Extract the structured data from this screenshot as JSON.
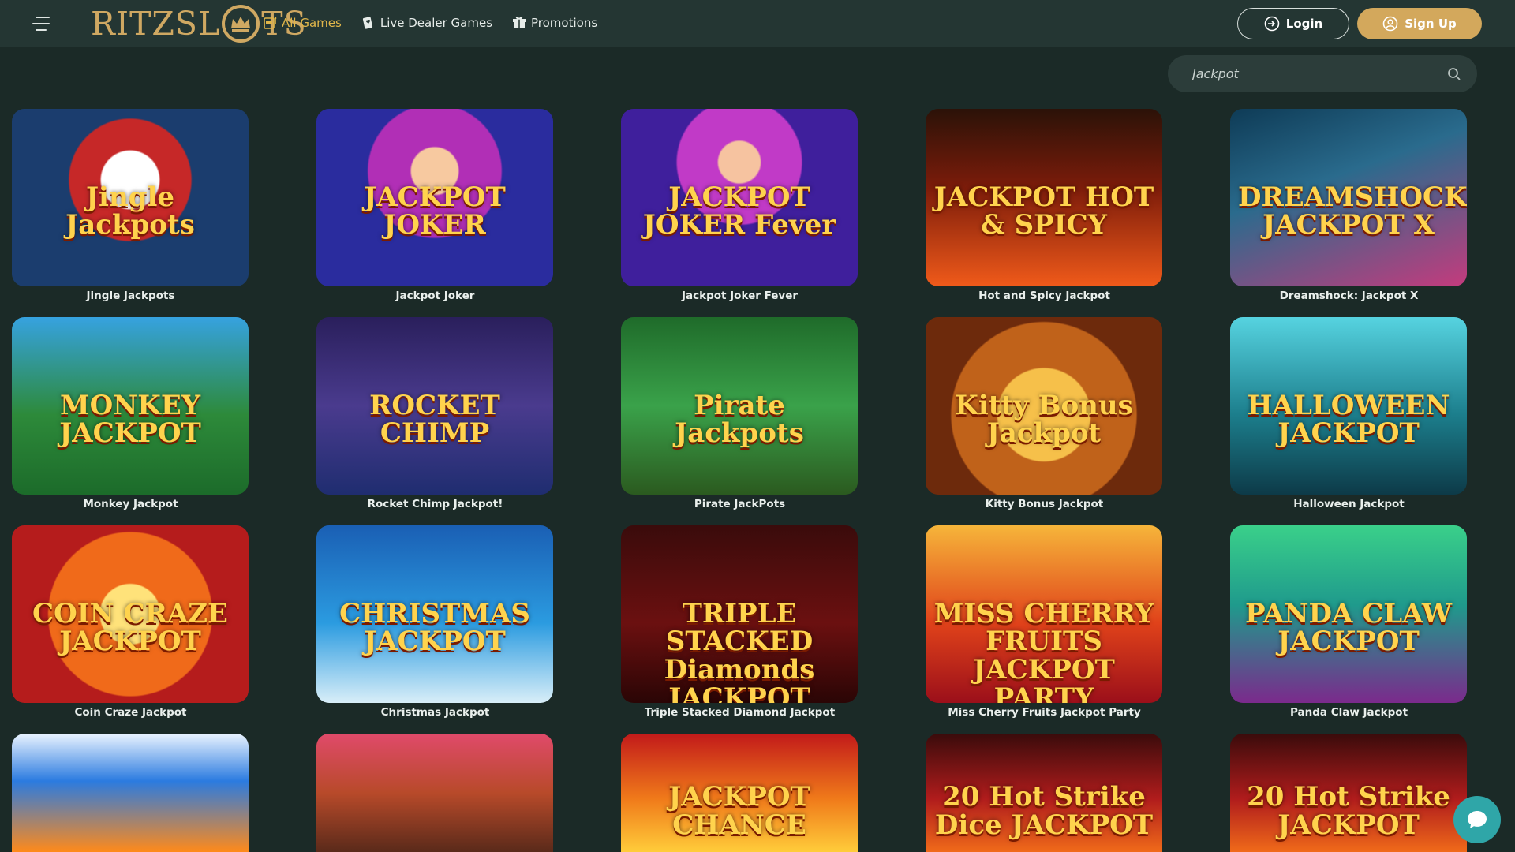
{
  "header": {
    "logo_text": "RITZSL",
    "logo_text_end": "TS",
    "nav": [
      {
        "label": "All Games",
        "icon": "slot-machine-icon",
        "active": true
      },
      {
        "label": "Live Dealer Games",
        "icon": "cards-icon",
        "active": false
      },
      {
        "label": "Promotions",
        "icon": "gift-icon",
        "active": false
      }
    ],
    "login_label": "Login",
    "signup_label": "Sign Up"
  },
  "search": {
    "value": "Jackpot",
    "icon": "search-icon"
  },
  "games": [
    {
      "title": "Jingle Jackpots",
      "art": "Jingle Jackpots"
    },
    {
      "title": "Jackpot Joker",
      "art": "JACKPOT JOKER"
    },
    {
      "title": "Jackpot Joker Fever",
      "art": "JACKPOT JOKER Fever"
    },
    {
      "title": "Hot and Spicy Jackpot",
      "art": "JACKPOT HOT & SPICY"
    },
    {
      "title": "Dreamshock: Jackpot X",
      "art": "DREAMSHOCK JACKPOT X"
    },
    {
      "title": "Monkey Jackpot",
      "art": "MONKEY JACKPOT"
    },
    {
      "title": "Rocket Chimp Jackpot!",
      "art": "ROCKET CHIMP"
    },
    {
      "title": "Pirate JackPots",
      "art": "Pirate Jackpots"
    },
    {
      "title": "Kitty Bonus Jackpot",
      "art": "Kitty Bonus Jackpot"
    },
    {
      "title": "Halloween Jackpot",
      "art": "HALLOWEEN JACKPOT"
    },
    {
      "title": "Coin Craze Jackpot",
      "art": "COIN CRAZE JACKPOT"
    },
    {
      "title": "Christmas Jackpot",
      "art": "CHRISTMAS JACKPOT"
    },
    {
      "title": "Triple Stacked Diamond Jackpot",
      "art": "TRIPLE STACKED Diamonds JACKPOT"
    },
    {
      "title": "Miss Cherry Fruits Jackpot Party",
      "art": "MISS CHERRY FRUITS JACKPOT PARTY"
    },
    {
      "title": "Panda Claw Jackpot",
      "art": "PANDA CLAW JACKPOT"
    },
    {
      "title": "",
      "art": ""
    },
    {
      "title": "",
      "art": ""
    },
    {
      "title": "",
      "art": "JACKPOT CHANCE"
    },
    {
      "title": "",
      "art": "20 Hot Strike Dice JACKPOT"
    },
    {
      "title": "",
      "art": "20 Hot Strike JACKPOT"
    }
  ],
  "colors": {
    "accent": "#d3a85c",
    "active_nav": "#e0b64a",
    "background": "#1b2a27",
    "header": "#243633",
    "chat": "#2fa6a8"
  },
  "chat_icon": "chat-bubble-icon"
}
